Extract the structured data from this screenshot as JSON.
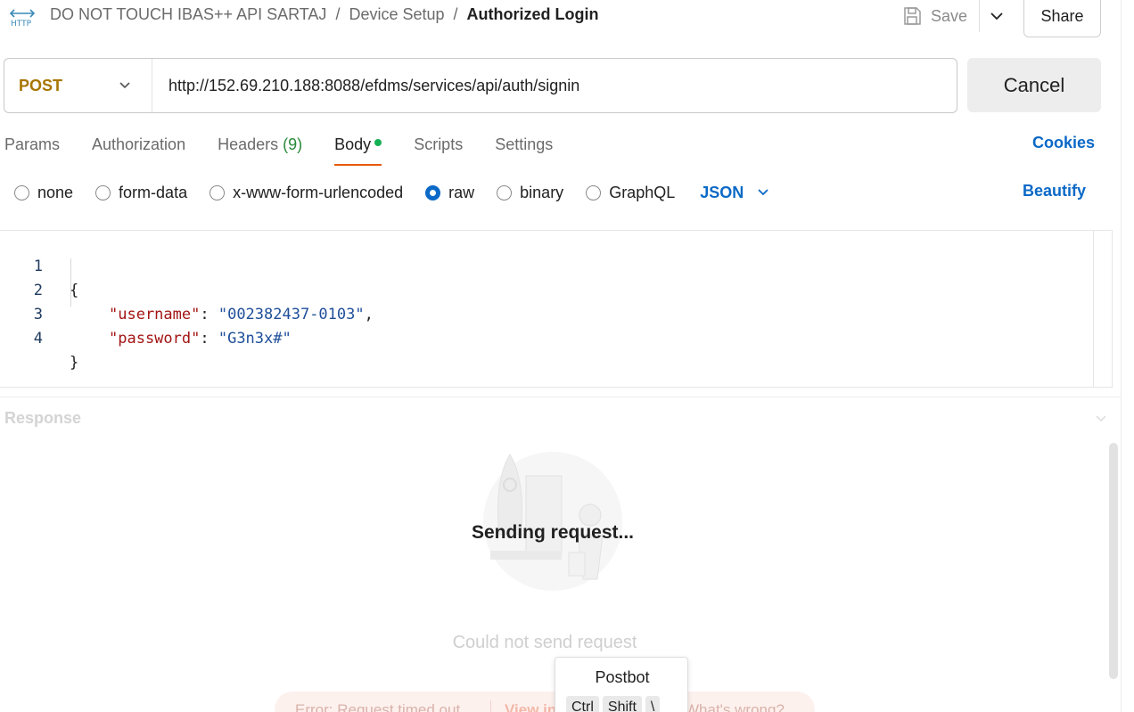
{
  "header": {
    "icon": "http-icon",
    "breadcrumb": [
      "DO NOT TOUCH IBAS++ API SARTAJ",
      "Device Setup",
      "Authorized Login"
    ],
    "save_label": "Save",
    "share_label": "Share"
  },
  "request": {
    "method": "POST",
    "url": "http://152.69.210.188:8088/efdms/services/api/auth/signin",
    "cancel_label": "Cancel"
  },
  "tabs": [
    {
      "label": "Params"
    },
    {
      "label": "Authorization"
    },
    {
      "label": "Headers",
      "count": "(9)"
    },
    {
      "label": "Body",
      "active": true
    },
    {
      "label": "Scripts"
    },
    {
      "label": "Settings"
    }
  ],
  "cookies_label": "Cookies",
  "body_types": [
    "none",
    "form-data",
    "x-www-form-urlencoded",
    "raw",
    "binary",
    "GraphQL"
  ],
  "body_type_selected": "raw",
  "body_format": "JSON",
  "beautify_label": "Beautify",
  "editor": {
    "line_numbers": [
      "1",
      "2",
      "3",
      "4"
    ],
    "open_brace": "{",
    "close_brace": "}",
    "lines": [
      {
        "key": "\"username\"",
        "value": "\"002382437-0103\"",
        "trail": ","
      },
      {
        "key": "\"password\"",
        "value": "\"G3n3x#\"",
        "trail": ""
      }
    ]
  },
  "response": {
    "label": "Response",
    "status": "Sending request...",
    "faded_message": "Could not send request",
    "error_text": "Error: Request timed out",
    "view_link": "View in",
    "wrong_link": "What's wrong?"
  },
  "postbot": {
    "title": "Postbot",
    "keys": [
      "Ctrl",
      "Shift",
      "\\"
    ]
  },
  "colors": {
    "accent_blue": "#0b69c7",
    "method_post": "#a77600",
    "active_tab_underline": "#e8590c",
    "body_dot": "#16b054"
  }
}
